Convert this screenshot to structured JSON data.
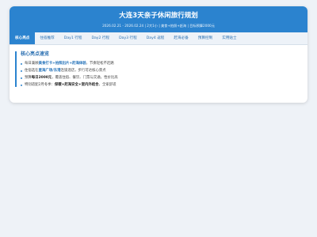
{
  "header": {
    "title": "大连3天亲子休闲旅行规划",
    "subtitle": "2026.02.21 - 2026.02.24 | 2大1小 | 美食+拍照+赶海 | 目标预算2000元"
  },
  "tabs": [
    {
      "label": "核心亮点",
      "active": true
    },
    {
      "label": "住宿推荐",
      "active": false
    },
    {
      "label": "Day1 行程",
      "active": false
    },
    {
      "label": "Day2 行程",
      "active": false
    },
    {
      "label": "Day3 行程",
      "active": false
    },
    {
      "label": "Day4 返程",
      "active": false
    },
    {
      "label": "赶海必备",
      "active": false
    },
    {
      "label": "预算控制",
      "active": false
    },
    {
      "label": "实用贴士",
      "active": false
    }
  ],
  "section": {
    "title": "核心亮点速览",
    "items": [
      {
        "pre": "每日兼顾",
        "hl": "美食打卡+拍照出片+赶海体验",
        "post": "，节奏轻松不赶路"
      },
      {
        "pre": "住宿选在",
        "hl": "星海广场/东港",
        "post": "连锁酒店，步行可达核心景点"
      },
      {
        "pre": "预算",
        "hl": "每日2000元",
        "post": "，覆盖住宿、餐饮、门票与交通，性价比高"
      },
      {
        "pre": "特别适配2月冬季：",
        "hl": "保暖+赶海安全+室内外结合",
        "post": "，全家舒适"
      }
    ]
  },
  "colors": {
    "accent": "#2b83cf",
    "background": "#eef2f7"
  }
}
